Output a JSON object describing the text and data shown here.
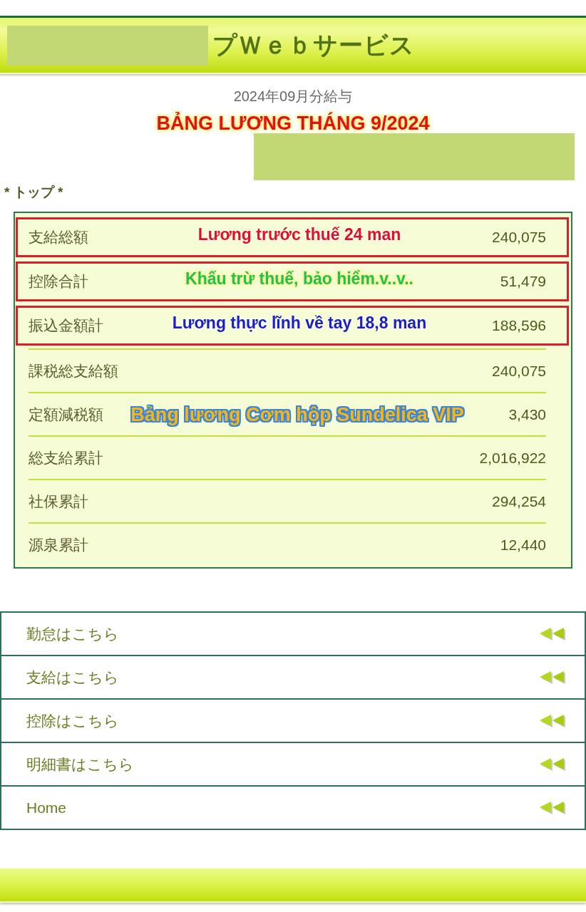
{
  "header": {
    "title": "プＷｅｂサービス"
  },
  "period": "2024年09月分給与",
  "banner": {
    "text": "BẢNG LƯƠNG THÁNG 9/2024",
    "color": "#e0101e"
  },
  "section_title": "* トップ *",
  "summary": [
    {
      "label": "支給総額",
      "value": "240,075",
      "highlighted": true,
      "note": {
        "kind": "caption",
        "text": "Lương trước thuế 24 man",
        "color": "#e0102a"
      }
    },
    {
      "label": "控除合計",
      "value": "51,479",
      "highlighted": true,
      "note": {
        "kind": "glow",
        "text": "Khấu trừ thuế, bảo hiểm.v..v..",
        "color": "#1fbf5e"
      }
    },
    {
      "label": "振込金額計",
      "value": "188,596",
      "highlighted": true,
      "note": {
        "kind": "caption",
        "text": "Lương thực lĩnh về tay 18,8 man",
        "color": "#1c20c4"
      }
    },
    {
      "label": "課税総支給額",
      "value": "240,075",
      "highlighted": false
    },
    {
      "label": "定額減税額",
      "value": "3,430",
      "highlighted": false,
      "note": {
        "kind": "sticker",
        "text": "Bảng lương Cơm hộp Sundelica VIP",
        "color": "#f4b41a"
      }
    },
    {
      "label": "総支給累計",
      "value": "2,016,922",
      "highlighted": false
    },
    {
      "label": "社保累計",
      "value": "294,254",
      "highlighted": false
    },
    {
      "label": "源泉累計",
      "value": "12,440",
      "highlighted": false
    }
  ],
  "menu": [
    {
      "label": "勤怠はこちら"
    },
    {
      "label": "支給はこちら"
    },
    {
      "label": "控除はこちら"
    },
    {
      "label": "明細書はこちら"
    },
    {
      "label": "Home"
    }
  ]
}
